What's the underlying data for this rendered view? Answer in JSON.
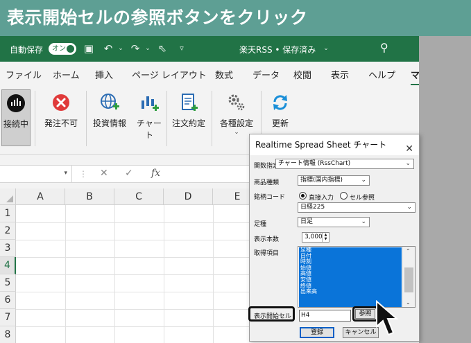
{
  "banner": {
    "text": "表示開始セルの参照ボタンをクリック"
  },
  "titlebar": {
    "autosave_label": "自動保存",
    "autosave_toggle": "オン",
    "document": "楽天RSS • 保存済み",
    "icons": [
      "save-icon",
      "undo-icon",
      "redo-icon",
      "pointer-icon",
      "customize-icon",
      "search-icon"
    ]
  },
  "tabs": [
    "ファイル",
    "ホーム",
    "挿入",
    "ページ レイアウト",
    "数式",
    "データ",
    "校閲",
    "表示",
    "ヘルプ",
    "マ"
  ],
  "ribbon": {
    "buttons": [
      {
        "label": "接続中",
        "icon": "connection-icon"
      },
      {
        "label": "発注不可",
        "icon": "error-icon"
      },
      {
        "label": "投資情報",
        "icon": "globe-icon"
      },
      {
        "label": "チャート",
        "icon": "chart-icon"
      },
      {
        "label": "注文約定",
        "icon": "order-icon"
      },
      {
        "label": "各種設定",
        "icon": "settings-icon"
      },
      {
        "label": "更新",
        "icon": "refresh-icon"
      }
    ]
  },
  "formulabar": {
    "fx": "fx"
  },
  "grid": {
    "columns": [
      "A",
      "B",
      "C",
      "D",
      "E"
    ],
    "rows": [
      "1",
      "2",
      "3",
      "4",
      "5",
      "6",
      "7",
      "8"
    ],
    "selected_row": "4"
  },
  "dialog": {
    "title": "Realtime Spread Sheet チャート",
    "function_label": "関数指定",
    "function_value": "チャート情報 (RssChart)",
    "product_label": "商品種類",
    "product_value": "指標(国内指標)",
    "code_label": "銘柄コード",
    "radio_direct": "直接入力",
    "radio_cell": "セル参照",
    "code_value": "日経225",
    "period_label": "足種",
    "period_value": "日足",
    "count_label": "表示本数",
    "count_value": "3,000",
    "items_label": "取得項目",
    "items": [
      "足種",
      "日付",
      "時刻",
      "始値",
      "高値",
      "安値",
      "終値",
      "出来高"
    ],
    "start_cell_label": "表示開始セル",
    "start_cell_value": "H4",
    "reference_button": "参照",
    "register_button": "登録",
    "cancel_button": "キャンセル"
  }
}
